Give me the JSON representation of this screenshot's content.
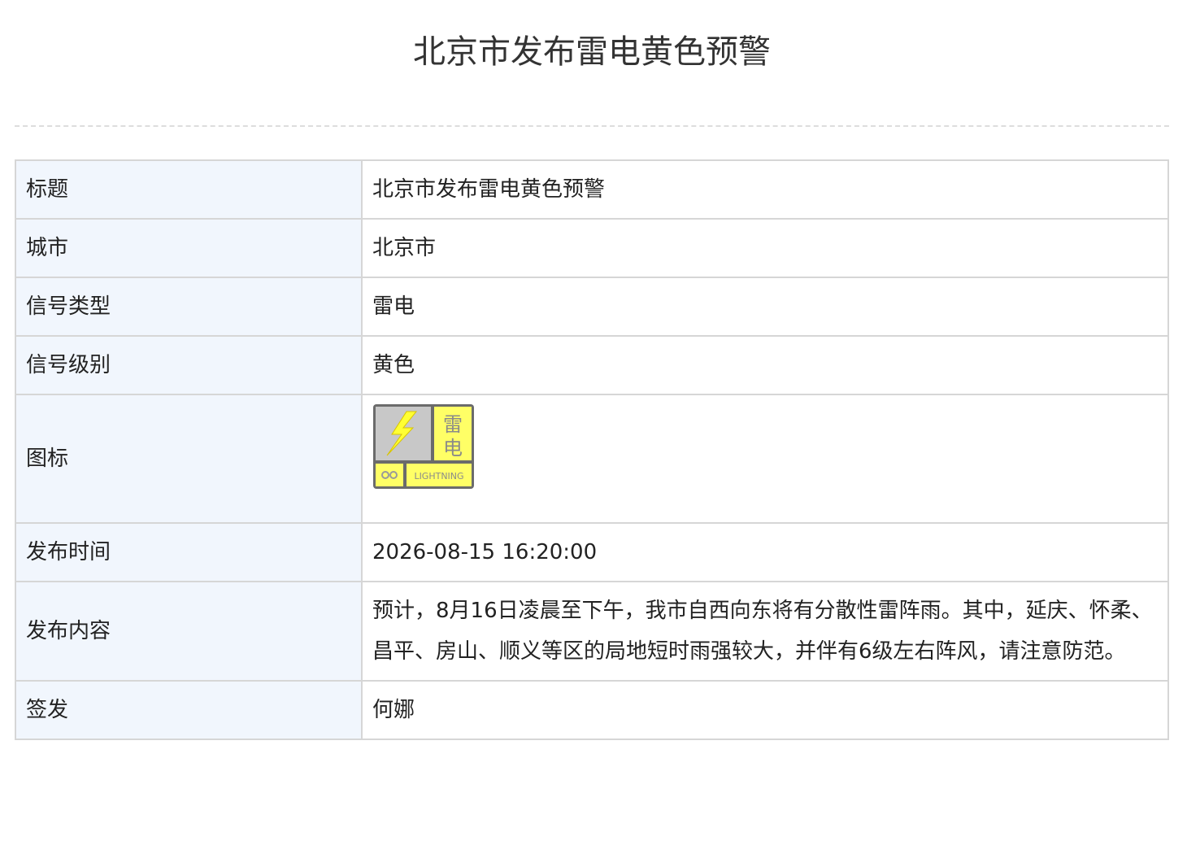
{
  "page": {
    "title": "北京市发布雷电黄色预警"
  },
  "table": {
    "rows": [
      {
        "label": "标题",
        "value": "北京市发布雷电黄色预警"
      },
      {
        "label": "城市",
        "value": "北京市"
      },
      {
        "label": "信号类型",
        "value": "雷电"
      },
      {
        "label": "信号级别",
        "value": "黄色"
      },
      {
        "label": "图标",
        "value": ""
      },
      {
        "label": "发布时间",
        "value": "2026-08-15 16:20:00"
      },
      {
        "label": "发布内容",
        "value": "预计，8月16日凌晨至下午，我市自西向东将有分散性雷阵雨。其中，延庆、怀柔、昌平、房山、顺义等区的局地短时雨强较大，并伴有6级左右阵风，请注意防范。"
      },
      {
        "label": "签发",
        "value": "何娜"
      }
    ]
  },
  "icon": {
    "name": "lightning-yellow-warning-icon",
    "char_top": "雷",
    "char_bottom": "电",
    "caption": "LIGHTNING",
    "colors": {
      "yellow": "#ffff66",
      "gray": "#a9a9a9",
      "dark": "#6b6b6b",
      "bolt": "#ffff33"
    }
  },
  "colors": {
    "label_bg": "#f1f6fd",
    "border": "#d6d6d6",
    "title": "#333333"
  }
}
